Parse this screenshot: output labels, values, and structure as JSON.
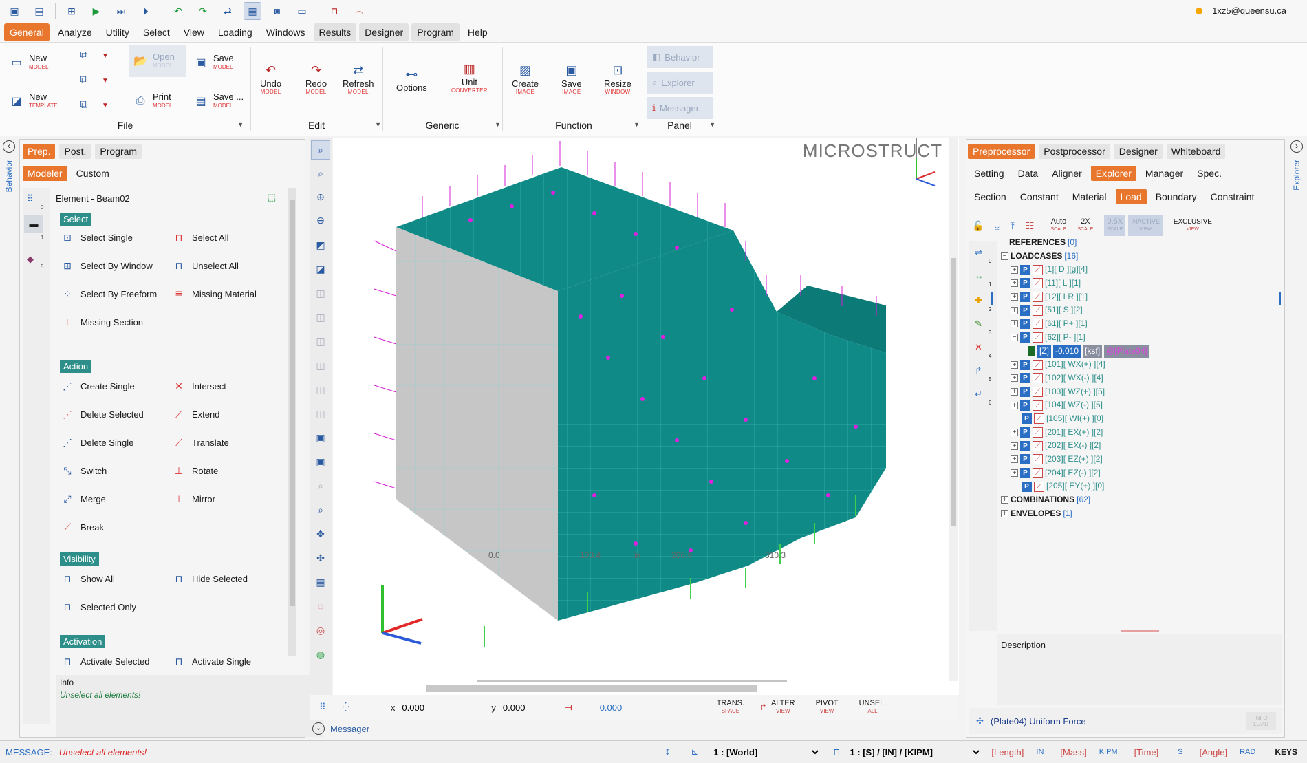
{
  "qat": {
    "user": "1xz5@queensu.ca",
    "icons": [
      "save-icon",
      "save-as-icon",
      "model-icon",
      "run-icon",
      "step-icon",
      "step-run-icon",
      "undo-icon",
      "redo-icon",
      "swap-icon",
      "view-icon",
      "camera-icon",
      "window-icon",
      "layout-icon",
      "bridge-icon"
    ]
  },
  "menu": [
    "General",
    "Analyze",
    "Utility",
    "Select",
    "View",
    "Loading",
    "Windows",
    "Results",
    "Designer",
    "Program",
    "Help"
  ],
  "ribbon": {
    "file": {
      "label": "File",
      "new_model": "New",
      "new_model_sub": "MODEL",
      "new_template": "New",
      "new_template_sub": "TEMPLATE",
      "open": "Open",
      "open_sub": "MODEL",
      "print": "Print",
      "print_sub": "MODEL",
      "save": "Save",
      "save_sub": "MODEL",
      "saveas": "Save ...",
      "saveas_sub": "MODEL"
    },
    "edit": {
      "label": "Edit",
      "undo": "Undo",
      "undo_sub": "MODEL",
      "redo": "Redo",
      "redo_sub": "MODEL",
      "refresh": "Refresh",
      "refresh_sub": "MODEL"
    },
    "generic": {
      "label": "Generic",
      "options": "Options",
      "unit": "Unit",
      "unit_sub": "CONVERTER"
    },
    "function": {
      "label": "Function",
      "create": "Create",
      "create_sub": "IMAGE",
      "save": "Save",
      "save_sub": "IMAGE",
      "resize": "Resize",
      "resize_sub": "WINDOW"
    },
    "panel": {
      "label": "Panel",
      "behavior": "Behavior",
      "explorer": "Explorer",
      "messager": "Messager"
    }
  },
  "left": {
    "side_label": "Behavior",
    "tabs": [
      "Prep.",
      "Post.",
      "Program"
    ],
    "subtabs": [
      "Modeler",
      "Custom"
    ],
    "element_title": "Element - Beam02",
    "select_hdr": "Select",
    "select": [
      "Select Single",
      "Select All",
      "Select By Window",
      "Unselect All",
      "Select By Freeform",
      "Missing Material",
      "Missing Section"
    ],
    "action_hdr": "Action",
    "action": [
      "Create Single",
      "Intersect",
      "Delete Selected",
      "Extend",
      "Delete Single",
      "Translate",
      "Switch",
      "Rotate",
      "Merge",
      "Mirror",
      "Break"
    ],
    "visibility_hdr": "Visibility",
    "visibility": [
      "Show All",
      "Hide Selected",
      "Selected Only"
    ],
    "activation_hdr": "Activation",
    "activation": [
      "Activate Selected",
      "Activate Single"
    ],
    "info_label": "Info",
    "info_text": "Unselect all elements!",
    "row_nums": [
      "0",
      "1",
      "5"
    ]
  },
  "viewport": {
    "brand": "MICROSTRUCT",
    "ruler": [
      "0.0",
      "103.4",
      "in",
      "206.9",
      "310.3"
    ],
    "x_label": "x",
    "x_val": "0.000",
    "y_label": "y",
    "y_val": "0.000",
    "z_val": "0.000",
    "trans": "TRANS.",
    "trans_sub": "SPACE",
    "alter": "ALTER",
    "alter_sub": "VIEW",
    "pivot": "PIVOT",
    "pivot_sub": "VIEW",
    "unsel": "UNSEL.",
    "unsel_sub": "ALL",
    "messager": "Messager"
  },
  "right": {
    "side_label": "Explorer",
    "tabs": [
      "Preprocessor",
      "Postprocessor",
      "Designer",
      "Whiteboard"
    ],
    "tabs2": [
      "Setting",
      "Data",
      "Aligner",
      "Explorer",
      "Manager",
      "Spec."
    ],
    "tabs3": [
      "Section",
      "Constant",
      "Material",
      "Load",
      "Boundary",
      "Constraint"
    ],
    "toolbar": {
      "auto": "Auto",
      "auto_sub": "SCALE",
      "x2": "2X",
      "x2_sub": "SCALE",
      "half": "0.5X",
      "half_sub": "SCALE",
      "inactive": "INACTIVE",
      "inactive_sub": "VIEW",
      "exclusive": "EXCLUSIVE",
      "exclusive_sub": "VIEW"
    },
    "gutter_nums": [
      "0",
      "1",
      "2",
      "3",
      "4",
      "5",
      "6"
    ],
    "tree": {
      "references": "REFERENCES",
      "references_count": "[0]",
      "loadcases": "LOADCASES",
      "loadcases_count": "[16]",
      "cases": [
        "[1][ D ][g][4]",
        "[11][ L ][1]",
        "[12][ LR ][1]",
        "[51][ S ][2]",
        "[61][ P+ ][1]",
        "[62][ P- ][1]",
        "[101][ WX(+) ][4]",
        "[102][ WX(-) ][4]",
        "[103][ WZ(+) ][5]",
        "[104][ WZ(-) ][5]",
        "[105][ WI(+) ][0]",
        "[201][ EX(+) ][2]",
        "[202][ EX(-) ][2]",
        "[203][ EZ(+) ][2]",
        "[204][ EZ(-) ][2]",
        "[205][ EY(+) ][0]"
      ],
      "sel_tag": "[Z]",
      "sel_value": "-0.010",
      "sel_unit": "[ksf]",
      "sel_target": "@[Plate04]",
      "combinations": "COMBINATIONS",
      "combinations_count": "[62]",
      "envelopes": "ENVELOPES",
      "envelopes_count": "[1]"
    },
    "description": "Description",
    "footer": "(Plate04) Uniform Force",
    "footer_btn": "INFO LOAD"
  },
  "status": {
    "message_label": "MESSAGE:",
    "message": "Unselect all elements!",
    "world": "1 : [World]",
    "units": "1 : [S] / [IN] / [KIPM]",
    "length": "[Length]",
    "length_val": "IN",
    "mass": "[Mass]",
    "mass_val": "KIPM",
    "time": "[Time]",
    "time_val": "S",
    "angle": "[Angle]",
    "angle_val": "RAD",
    "keys": "KEYS"
  },
  "colors": {
    "accent": "#e8762d",
    "model": "#0f8a87",
    "section": "#2e8f8a",
    "load": "#d41fd4",
    "support": "#3fd14a"
  }
}
